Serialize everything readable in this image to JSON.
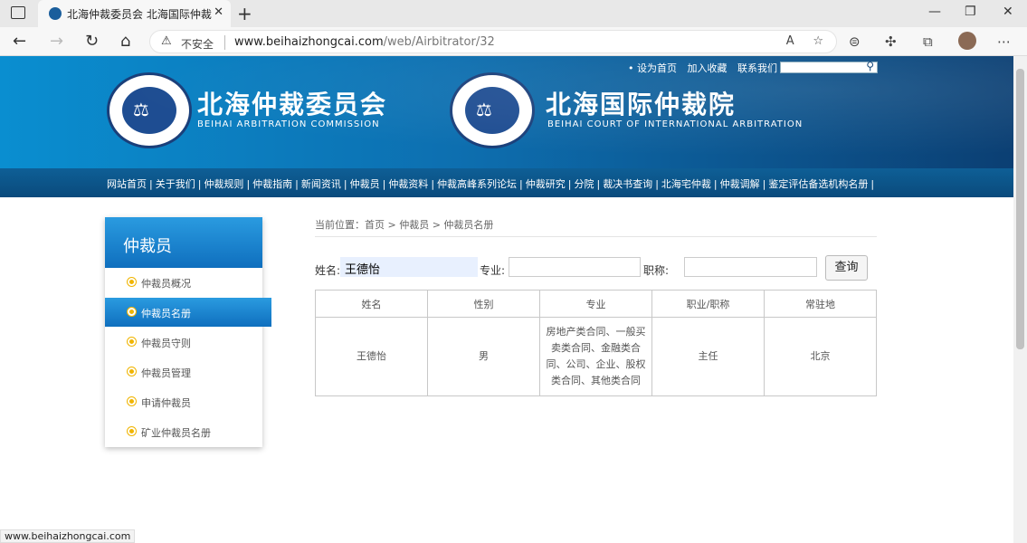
{
  "browser": {
    "tab_title": "北海仲裁委员会 北海国际仲裁院",
    "insecure_label": "不安全",
    "url_host": "www.beihaizhongcai.com",
    "url_path": "/web/Airbitrator/32",
    "status_url": "www.beihaizhongcai.com"
  },
  "header": {
    "toplinks": [
      "• 设为首页",
      "加入收藏",
      "联系我们"
    ],
    "org1_cn": "北海仲裁委员会",
    "org1_en": "BEIHAI ARBITRATION COMMISSION",
    "org2_cn": "北海国际仲裁院",
    "org2_en": "BEIHAI COURT OF INTERNATIONAL ARBITRATION"
  },
  "mainnav": [
    "网站首页",
    "关于我们",
    "仲裁规则",
    "仲裁指南",
    "新闻资讯",
    "仲裁员",
    "仲裁资料",
    "仲裁高峰系列论坛",
    "仲裁研究",
    "分院",
    "裁决书查询",
    "北海宅仲裁",
    "仲裁调解",
    "鉴定评估备选机构名册"
  ],
  "sidebar": {
    "title": "仲裁员",
    "items": [
      {
        "label": "仲裁员概况",
        "active": false
      },
      {
        "label": "仲裁员名册",
        "active": true
      },
      {
        "label": "仲裁员守则",
        "active": false
      },
      {
        "label": "仲裁员管理",
        "active": false
      },
      {
        "label": "申请仲裁员",
        "active": false
      },
      {
        "label": "矿业仲裁员名册",
        "active": false
      }
    ]
  },
  "breadcrumb": "当前位置：首页 > 仲裁员 > 仲裁员名册",
  "search": {
    "name_label": "姓名:",
    "name_value": "王德怡",
    "specialty_label": "专业:",
    "specialty_value": "",
    "title_label": "职称:",
    "title_value": "",
    "button_label": "查询"
  },
  "table": {
    "headers": [
      "姓名",
      "性别",
      "专业",
      "职业/职称",
      "常驻地"
    ],
    "rows": [
      [
        "王德怡",
        "男",
        "房地产类合同、一般买卖类合同、金融类合同、公司、企业、股权类合同、其他类合同",
        "主任",
        "北京"
      ]
    ]
  }
}
